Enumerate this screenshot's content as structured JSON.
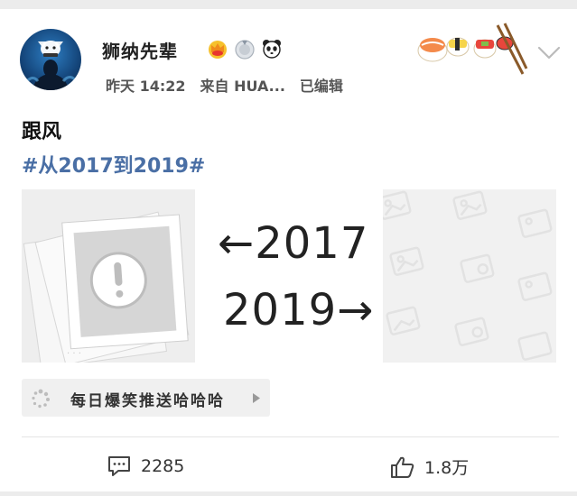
{
  "post": {
    "username": "狮纳先辈",
    "time": "昨天 14:22",
    "source": "来自 HUA...",
    "edited": "已编辑",
    "text": "跟风",
    "hashtag": "#从2017到2019#"
  },
  "badges": [
    "crown-badge-icon",
    "medal-badge-icon",
    "panda-badge-icon"
  ],
  "images": [
    {
      "name": "broken-image-tile",
      "state": "load-failed"
    },
    {
      "name": "year-compare-tile",
      "labels": {
        "top": "←2017",
        "bottom": "2019→"
      }
    },
    {
      "name": "placeholder-image-tile",
      "state": "loading"
    }
  ],
  "source_chip": {
    "label": "每日爆笑推送哈哈哈"
  },
  "actions": {
    "comments": "2285",
    "likes": "1.8万"
  },
  "colors": {
    "hashtag": "#4a6fa5",
    "background": "#ececec",
    "card": "#ffffff"
  }
}
